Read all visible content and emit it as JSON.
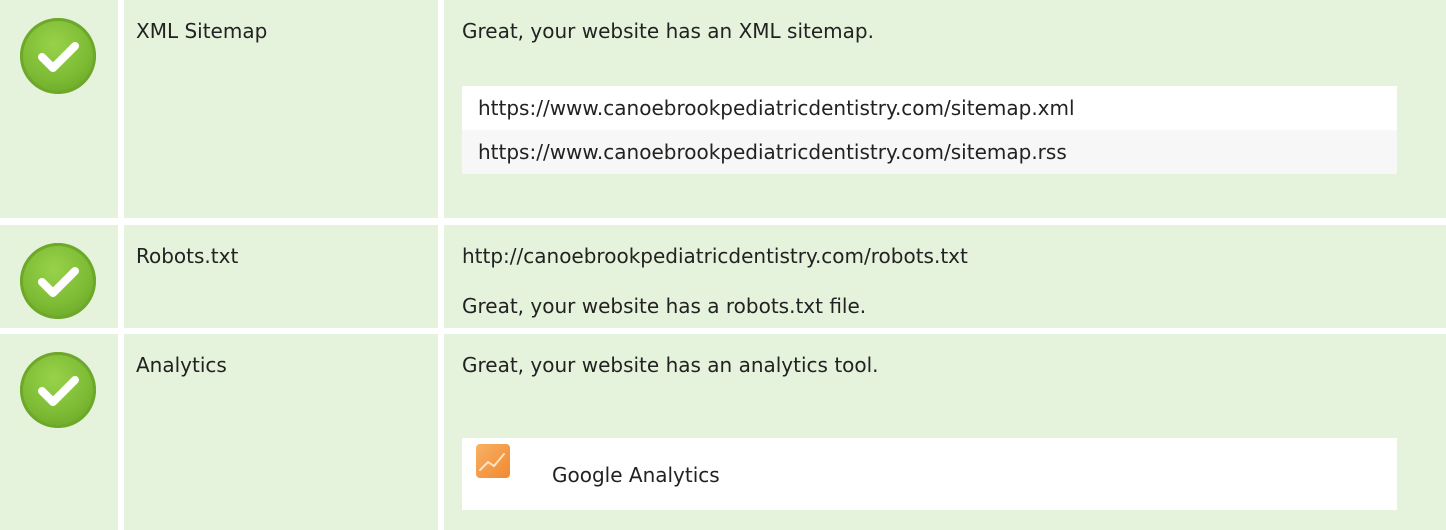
{
  "rows": [
    {
      "name": "XML Sitemap",
      "status_icon": "check-circle-icon",
      "message": "Great, your website has an XML sitemap.",
      "urls": [
        "https://www.canoebrookpediatricdentistry.com/sitemap.xml",
        "https://www.canoebrookpediatricdentistry.com/sitemap.rss"
      ]
    },
    {
      "name": "Robots.txt",
      "status_icon": "check-circle-icon",
      "url": "http://canoebrookpediatricdentistry.com/robots.txt",
      "message": "Great, your website has a robots.txt file."
    },
    {
      "name": "Analytics",
      "status_icon": "check-circle-icon",
      "message": "Great, your website has an analytics tool.",
      "tools": [
        {
          "icon": "google-analytics-icon",
          "label": "Google Analytics"
        }
      ]
    }
  ],
  "colors": {
    "row_background": "#e6f3dc",
    "check_green": "#7dbb34",
    "analytics_orange": "#f49844"
  }
}
